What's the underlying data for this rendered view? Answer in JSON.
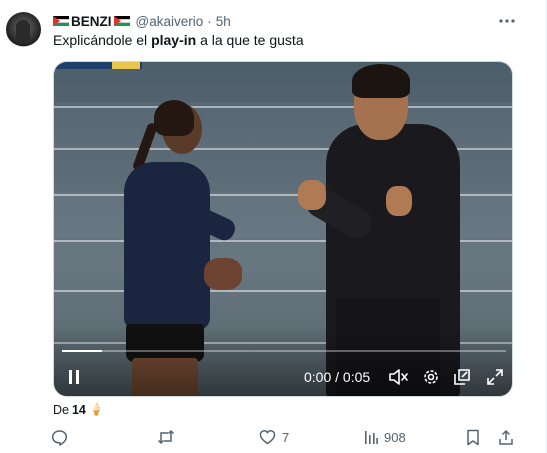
{
  "tweet": {
    "author_name": "BENZI",
    "handle": "@akaiverio",
    "separator": "·",
    "time": "5h",
    "text_before": "Explicándole el ",
    "text_bold": "play-in",
    "text_after": " a la que te gusta"
  },
  "video": {
    "timecode": "0:00 / 0:05",
    "progress": 0.09
  },
  "meta": {
    "prefix": "De",
    "count": "14",
    "emoji": "🍦"
  },
  "actions": {
    "replies": "",
    "retweets": "",
    "likes": "7",
    "views": "908"
  },
  "icons": {
    "more": "more-icon",
    "reply": "reply-icon",
    "retweet": "retweet-icon",
    "like": "heart-icon",
    "views": "views-icon",
    "bookmark": "bookmark-icon",
    "share": "share-icon",
    "play": "play-pause-icon",
    "mute": "mute-icon",
    "settings": "gear-icon",
    "popout": "popout-icon",
    "fullscreen": "fullscreen-icon"
  },
  "colors": {
    "text": "#0f1419",
    "secondary": "#536471",
    "flag_red": "#e4312b",
    "flag_green": "#149954"
  }
}
